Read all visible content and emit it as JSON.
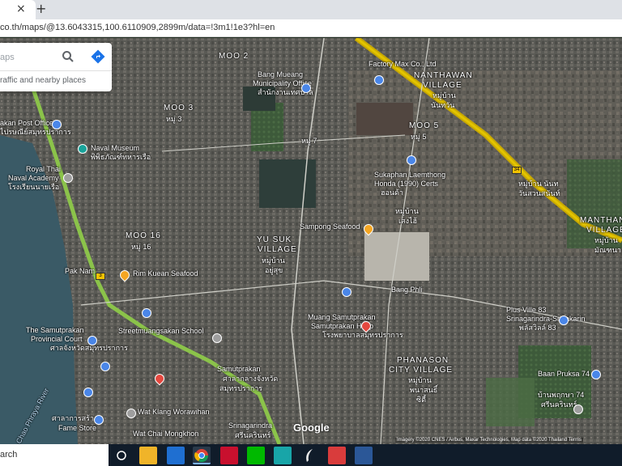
{
  "browser": {
    "tab_close": "×",
    "new_tab": "+",
    "url": "co.th/maps/@13.6043315,100.6110909,2899m/data=!3m1!1e3?hl=en"
  },
  "search": {
    "input_value": "aps",
    "hint": "raffic and nearby places"
  },
  "labels": {
    "moo2": "MOO 2",
    "moo2_th": "หมู่ 2",
    "bang_mueang": "Bang Mueang",
    "bang_mueang2": "Municipality Office",
    "bang_mueang_th": "สำนักงานเทศบาล",
    "factory_max": "Factory Max Co., Ltd",
    "nanthawan": "NANTHAWAN",
    "nanthawan2": "VILLAGE",
    "nanthawan_th": "หมู่บ้าน",
    "nanthawan_th2": "นันทวัน",
    "moo3": "MOO 3",
    "moo3_th": "หมู่ 3",
    "post_office": "akan Post Office",
    "post_office_th": "ไปรษณีย์สมุทรปราการ",
    "naval_museum": "Naval Museum",
    "naval_museum_th": "พิพิธภัณฑ์ทหารเรือ",
    "moo7_th": "หมู่ 7",
    "moo5": "MOO 5",
    "moo5_th": "หมู่ 5",
    "royal_thai": "Royal Thai",
    "naval_academy": "Naval Academy",
    "naval_academy_th": "โรงเรียนนายเรือ",
    "sukaphan": "Sukaphan Laemthong",
    "honda": "Honda (1990) Certs",
    "honda_th": "ฮอนด้า",
    "mooban_nan": "หมู่บ้าน นันท",
    "mooban_nan2": "วันสวนสนันท์",
    "mooban_seng": "หมู่บ้าน",
    "mooban_seng2": "เสงไฮ้",
    "manthana": "MANTHANA",
    "manthana2": "VILLAGE",
    "manthana_th": "หมู่บ้าน",
    "manthana_th2": "มัณฑนา",
    "sampong": "Sampong Seafood",
    "moo16": "MOO 16",
    "moo16_th": "หมู่ 16",
    "yusuk": "YU SUK",
    "yusuk2": "VILLAGE",
    "yusuk_th": "หมู่บ้าน",
    "yusuk_th2": "อยู่สุข",
    "pak_nam": "Pak Nam",
    "rim_kuean": "Rim Kuean Seafood",
    "bang_phli": "Bang Phli",
    "plaza": "Plus Ville 83",
    "plaza2": "Srinagarindra-Srinakarin",
    "plaza_th": "พลัสวิลล์ 83",
    "samutprakan_court": "The Samutprakan",
    "samutprakan_court2": "Provincial Court",
    "samutprakan_court_th": "ศาลจังหวัดสมุทรปราการ",
    "school": "Streetmuangsakan School",
    "hospital": "Muang Samutprakan",
    "hospital2": "Samutprakan Hosp",
    "hospital_th": "โรงพยาบาลสมุทรปราการ",
    "phanason": "PHANASON",
    "phanason2": "CITY VILLAGE",
    "phanason_th": "หมู่บ้าน",
    "phanason_th2": "พนาสนธิ์",
    "phanason_th3": "ซิตี้",
    "baan_pruksa74": "Baan Pruksa 74",
    "baan_pruksa74_th": "บ้านพฤกษา 74",
    "baan_pruksa74_2": "ศรีนครินทร์",
    "samutprakan_center": "Samutprakan",
    "samutprakan_center_th": "ศาลากลางจังหวัด",
    "samutprakan_center_th2": "สมุทรปราการ",
    "wat_klang": "Wat Klang Worawihan",
    "wat_chai": "Wat Chai Mongkhon",
    "srinagarindra": "Srinagarindra",
    "srinagarindra_th": "ศรีนครินทร์",
    "fire_station": "Fame Store",
    "fire_station_th": "ศาลาการสร้าง",
    "river": "Chao Phraya River",
    "motorway_shield": "34",
    "route_shield": "3"
  },
  "map": {
    "google_logo": "Google",
    "attribution": "Imagery ©2020 CNES / Airbus, Maxar Technologies, Map data ©2020    Thailand    Terms"
  },
  "taskbar": {
    "search_text": "arch",
    "icons": [
      "circle-icon",
      "task-view-icon",
      "file-explorer-icon",
      "mail-icon",
      "chrome-icon",
      "acrobat-icon",
      "line-icon",
      "photoshop-icon",
      "feather-icon",
      "camera-icon",
      "word-icon"
    ]
  },
  "colors": {
    "road_green": "#8bc34a",
    "motorway_yellow": "#d8b800",
    "water": "#3a5a66",
    "poi_blue": "#4a86e8",
    "poi_orange": "#f5a623",
    "poi_red": "#e5483f"
  }
}
